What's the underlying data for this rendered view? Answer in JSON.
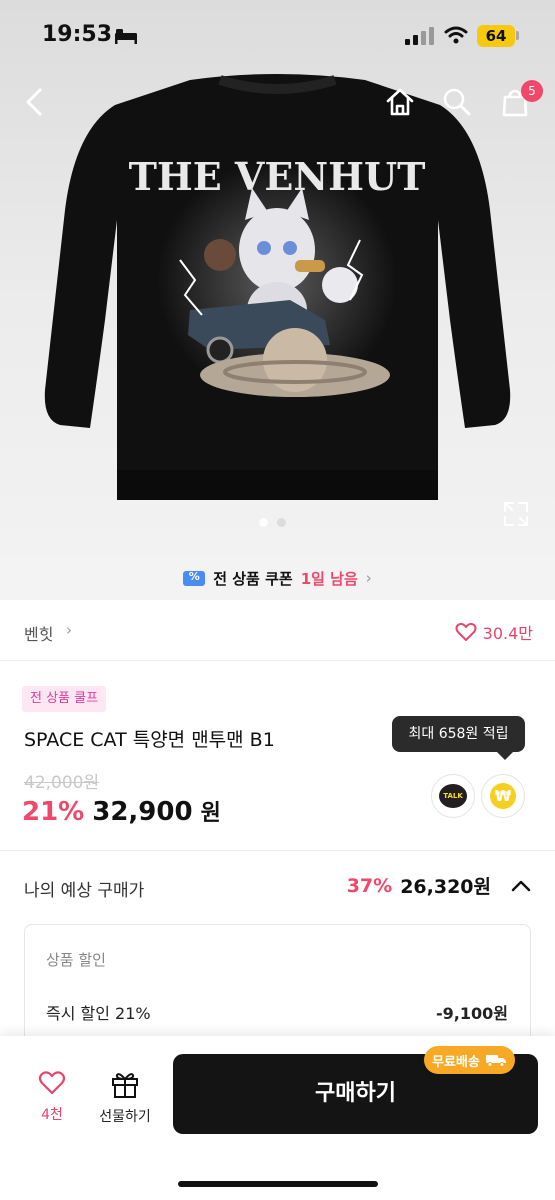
{
  "status": {
    "time": "19:53",
    "battery": "64"
  },
  "nav": {
    "cart_count": "5"
  },
  "gallery": {
    "print_text": "THE VENHUT",
    "current_index": 1,
    "total": 2
  },
  "coupon": {
    "text": "전 상품 쿠폰",
    "days": "1일 남음"
  },
  "brand": {
    "name": "벤힛",
    "likes": "30.4만"
  },
  "product": {
    "tag": "전 상품 쿨프",
    "name": "SPACE CAT 특양면 맨투맨 B1",
    "original_price": "42,000원",
    "discount": "21%",
    "price": "32,900",
    "price_unit": "원",
    "tooltip": "최대 658원 적립",
    "talk_label": "TALK",
    "point_label": "₩"
  },
  "estimate": {
    "label": "나의 예상 구매가",
    "percent": "37%",
    "price": "26,320원",
    "section_title": "상품 할인",
    "row_label": "즉시 할인 21%",
    "row_value": "-9,100원"
  },
  "bottom": {
    "wish_count": "4천",
    "gift_label": "선물하기",
    "buy_label": "구매하기",
    "ship_label": "무료배송"
  },
  "colors": {
    "accent_pink": "#f0486b",
    "buy_button": "#141414",
    "ship_badge": "#f7a825"
  }
}
